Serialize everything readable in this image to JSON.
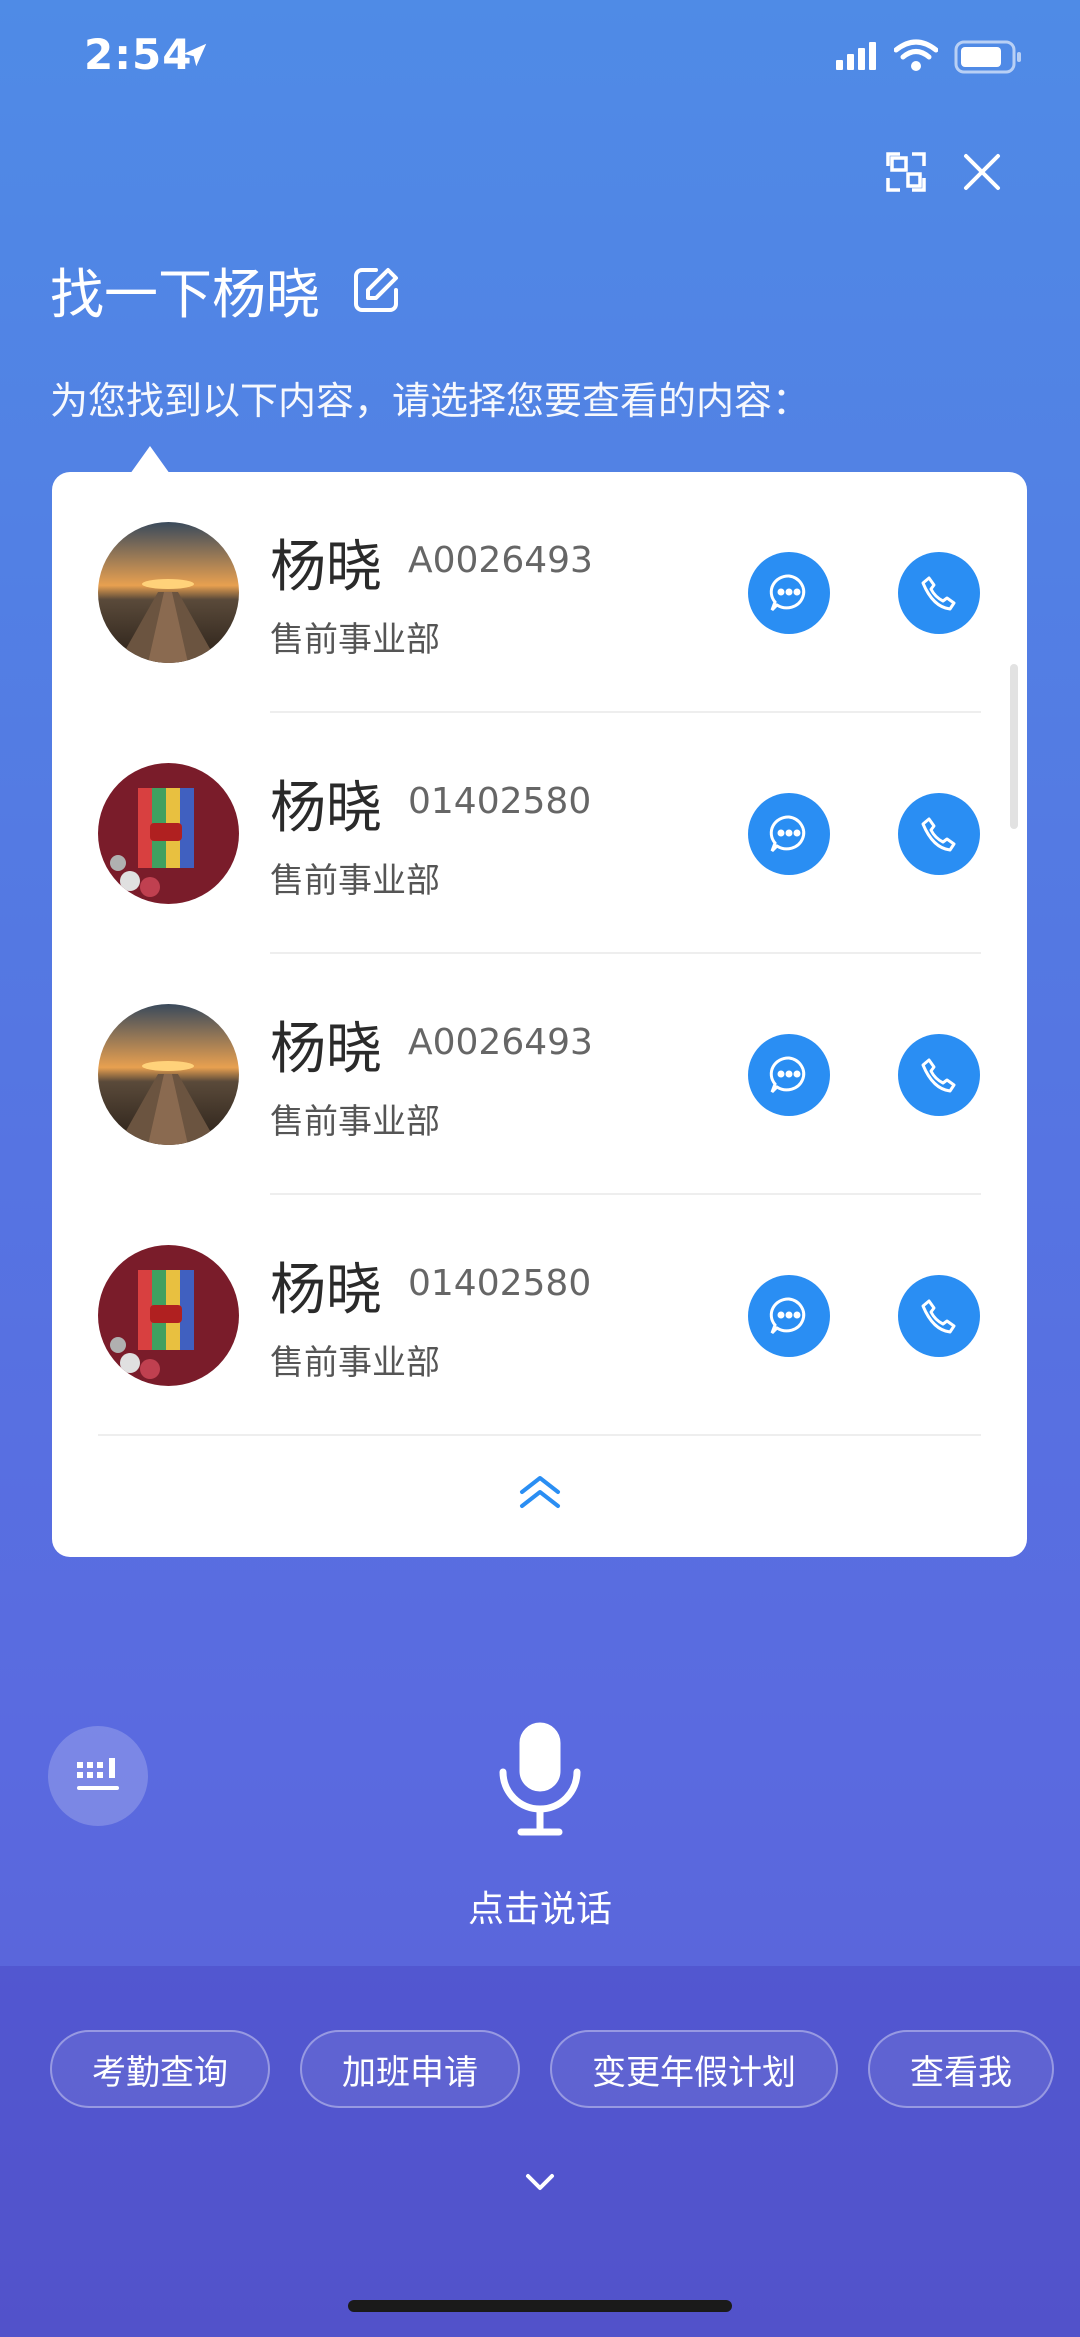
{
  "status_bar": {
    "time": "2:54"
  },
  "query": {
    "text": "找一下杨晓"
  },
  "hint": "为您找到以下内容，请选择您要查看的内容：",
  "contacts": [
    {
      "name": "杨晓",
      "id": "A0026493",
      "dept": "售前事业部",
      "avatar": "pier-sunset"
    },
    {
      "name": "杨晓",
      "id": "01402580",
      "dept": "售前事业部",
      "avatar": "domo-toy"
    },
    {
      "name": "杨晓",
      "id": "A0026493",
      "dept": "售前事业部",
      "avatar": "pier-sunset"
    },
    {
      "name": "杨晓",
      "id": "01402580",
      "dept": "售前事业部",
      "avatar": "domo-toy"
    }
  ],
  "voice": {
    "label": "点击说话"
  },
  "chips": [
    "考勤查询",
    "加班申请",
    "变更年假计划",
    "查看我"
  ],
  "colors": {
    "accent": "#2a8ef3",
    "card": "#ffffff"
  }
}
